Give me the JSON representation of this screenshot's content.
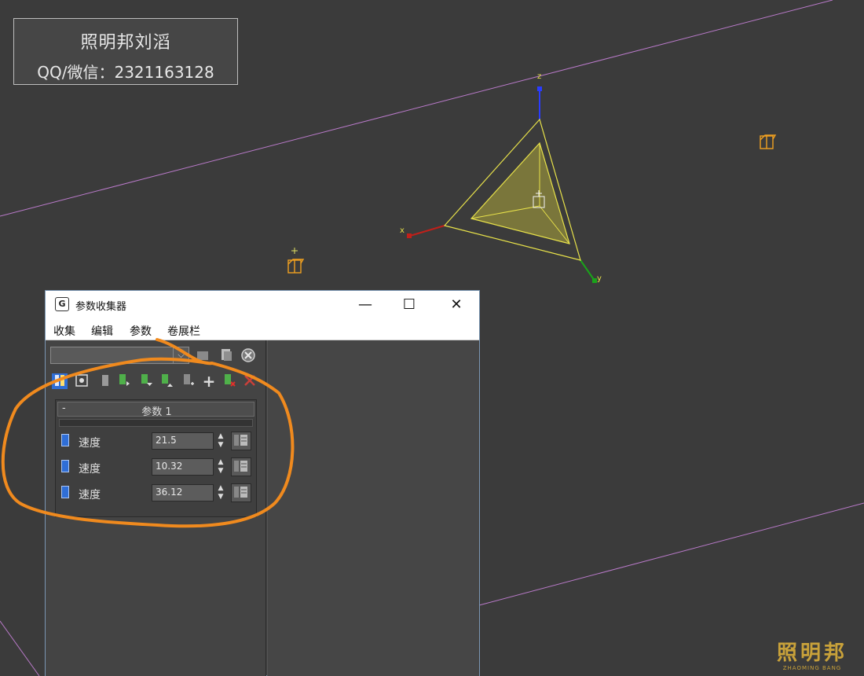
{
  "watermark": {
    "line1": "照明邦刘滔",
    "line2": "QQ/微信：2321163128"
  },
  "logo": {
    "text": "照明邦",
    "subtext": "ZHAOMING BANG"
  },
  "scene": {
    "axis_x": "x",
    "axis_y": "y",
    "axis_z": "z"
  },
  "window": {
    "title": "参数收集器",
    "minimize": "—",
    "maximize": "☐",
    "close": "✕",
    "menu": [
      "收集",
      "编辑",
      "参数",
      "卷展栏"
    ]
  },
  "rollout": {
    "collapse_glyph": "-",
    "title": "参数 1",
    "params": [
      {
        "label": "速度",
        "value": "21.5"
      },
      {
        "label": "速度",
        "value": "10.32"
      },
      {
        "label": "速度",
        "value": "36.12"
      }
    ]
  },
  "icons": {
    "combo_arrow": "chevron-down-icon",
    "toolbar": [
      "new-collection-icon",
      "save-collection-icon",
      "delete-collection-icon",
      "select-icon",
      "target-icon",
      "separator-icon",
      "add-icon",
      "add-down-icon",
      "add-up-icon",
      "add-selected-icon",
      "plus-icon",
      "remove-icon",
      "clear-icon"
    ]
  },
  "colors": {
    "annotation": "#f08a1e",
    "selection": "#e8e24a",
    "wire": "#c77dd6",
    "param_swatch": "#2f6ed6"
  }
}
